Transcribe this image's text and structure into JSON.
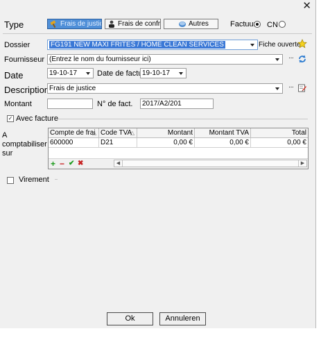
{
  "titlebar": {
    "close": "✕"
  },
  "type": {
    "label": "Type",
    "buttons": [
      "Frais de justice",
      "Frais de confrère",
      "Autres"
    ],
    "facture_label": "Factuur",
    "cn_label": "CN",
    "selected": "Factuur"
  },
  "dossier": {
    "label": "Dossier",
    "value": "FG191 NEW MAXI FRITES / HOME CLEAN SERVICES",
    "fiche_label": "Fiche ouverte"
  },
  "fournisseur": {
    "label": "Fournisseur",
    "placeholder": "(Entrez le nom du fournisseur ici)"
  },
  "date": {
    "label": "Date",
    "value": "19-10-17",
    "date_facture_label": "Date de facture",
    "date_facture_value": "19-10-17"
  },
  "description": {
    "label": "Description",
    "value": "Frais de justice"
  },
  "montant": {
    "label": "Montant",
    "value": "",
    "nfact_label": "N° de fact.",
    "nfact_value": "2017/A2/201"
  },
  "avec_facture": {
    "label": "Avec facture",
    "checked": true
  },
  "comptabiliser": {
    "label_lines": [
      "A",
      "comptabiliser",
      "sur"
    ],
    "columns": [
      "Compte de frai",
      "Code TVA",
      "Montant",
      "Montant TVA",
      "Total"
    ],
    "rows": [
      {
        "compte": "600000",
        "code": "D21",
        "montant": "0,00 €",
        "montant_tva": "0,00 €",
        "total": "0,00 €"
      }
    ]
  },
  "virement": {
    "label": "Virement",
    "checked": false
  },
  "buttons": {
    "ok": "Ok",
    "annuleren": "Annuleren"
  },
  "colors": {
    "selected_type_button": "#4f8fd8",
    "dossier_highlight": "#3a78d6",
    "add_icon": "#1a9a1a",
    "remove_icon": "#c62020"
  }
}
